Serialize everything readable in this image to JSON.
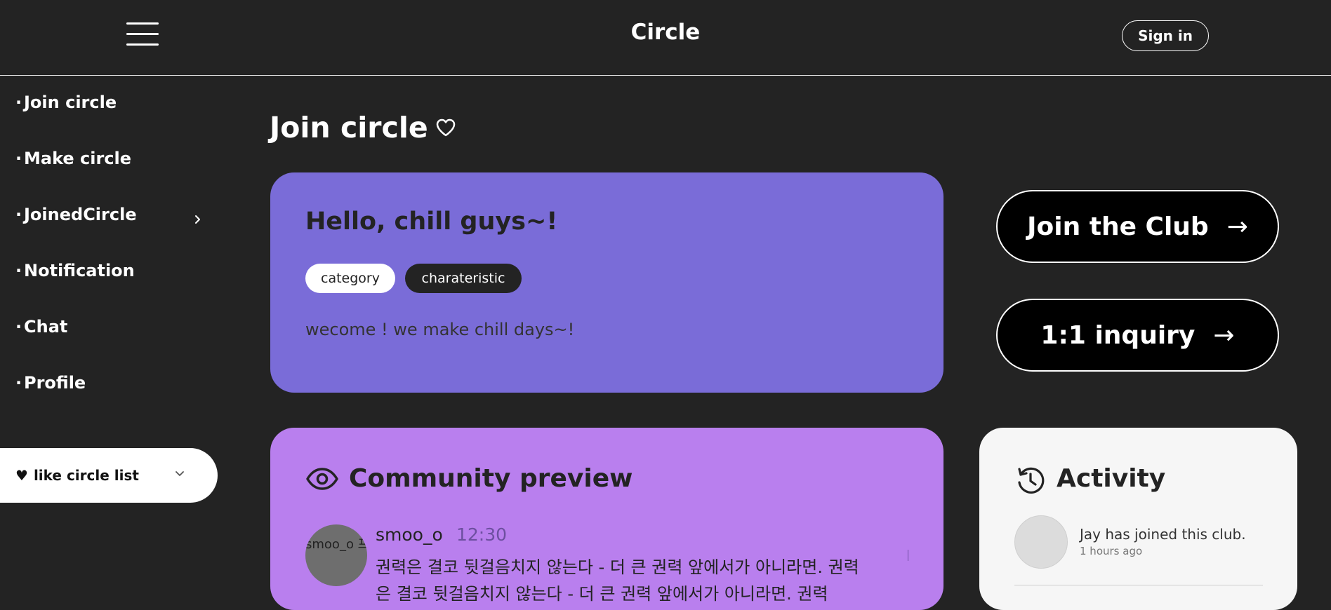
{
  "header": {
    "brand": "Circle",
    "signin_label": "Sign in"
  },
  "sidebar": {
    "bullet": "·",
    "items": [
      {
        "label": "Join circle"
      },
      {
        "label": "Make circle"
      },
      {
        "label": "JoinedCircle"
      },
      {
        "label": "Notification"
      },
      {
        "label": "Chat"
      },
      {
        "label": "Profile"
      }
    ],
    "like_list": {
      "heart": "♥",
      "label": "like circle list"
    }
  },
  "page": {
    "title": "Join circle"
  },
  "circle": {
    "title": "Hello, chill guys~!",
    "tags": [
      "category",
      "charateristic"
    ],
    "description": "wecome ! we make chill days~!"
  },
  "actions": {
    "join_label": "Join the Club",
    "inquiry_label": "1:1 inquiry",
    "arrow": "→"
  },
  "community": {
    "title": "Community preview",
    "post": {
      "avatar_alt": "smoo_o 프로필 이미지",
      "user": "smoo_o",
      "time": "12:30",
      "body": "권력은 결코 뒷걸음치지 않는다 - 더 큰 권력 앞에서가 아니라면. 권력은 결코 뒷걸음치지 않는다 - 더 큰 권력 앞에서가 아니라면. 권력"
    }
  },
  "activity": {
    "title": "Activity",
    "items": [
      {
        "text": "Jay has joined this club.",
        "time": "1 hours ago"
      }
    ]
  },
  "colors": {
    "background": "#232323",
    "welcome_card": "#7a6cd8",
    "community_card": "#b97fee",
    "activity_card": "#f6f6f6"
  }
}
